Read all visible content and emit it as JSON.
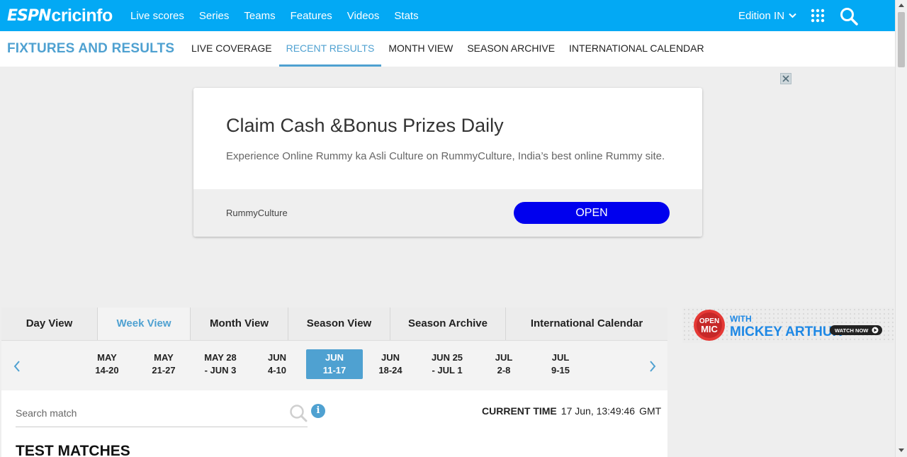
{
  "topbar": {
    "logo_espn": "ESPN",
    "logo_cric": "cricinfo",
    "nav": [
      "Live scores",
      "Series",
      "Teams",
      "Features",
      "Videos",
      "Stats"
    ],
    "edition": "Edition IN",
    "icons": {
      "apps": "grid-icon",
      "search": "search-icon",
      "chevron": "chevron-down-icon"
    },
    "bg_color": "#03a9f4"
  },
  "subbar": {
    "title": "FIXTURES AND RESULTS",
    "items": [
      "LIVE COVERAGE",
      "RECENT RESULTS",
      "MONTH VIEW",
      "SEASON ARCHIVE",
      "INTERNATIONAL CALENDAR"
    ],
    "active_index": 1,
    "accent_color": "#4fa1d1"
  },
  "ad": {
    "headline": "Claim Cash &Bonus Prizes Daily",
    "description": "Experience Online Rummy ka Asli Culture on RummyCulture, India’s best online Rummy site.",
    "brand": "RummyCulture",
    "cta": "OPEN",
    "cta_color": "#0000ee"
  },
  "views": {
    "tabs": [
      "Day View",
      "Week View",
      "Month View",
      "Season View",
      "Season Archive",
      "International Calendar"
    ],
    "active_index": 1
  },
  "weeks": {
    "items": [
      {
        "line1": "MAY",
        "line2": "14-20"
      },
      {
        "line1": "MAY",
        "line2": "21-27"
      },
      {
        "line1": "MAY 28",
        "line2": "- JUN 3"
      },
      {
        "line1": "JUN",
        "line2": "4-10"
      },
      {
        "line1": "JUN",
        "line2": "11-17"
      },
      {
        "line1": "JUN",
        "line2": "18-24"
      },
      {
        "line1": "JUN 25",
        "line2": "- JUL 1"
      },
      {
        "line1": "JUL",
        "line2": "2-8"
      },
      {
        "line1": "JUL",
        "line2": "9-15"
      }
    ],
    "active_index": 4
  },
  "search": {
    "placeholder": "Search match"
  },
  "time": {
    "label": "CURRENT TIME",
    "value": "17 Jun, 13:49:46",
    "tz": "GMT"
  },
  "section": {
    "heading": "TEST MATCHES"
  },
  "promo": {
    "line1": "OPEN",
    "line2": "MIC",
    "with": "WITH",
    "name": "MICKEY ARTHUR",
    "cta": "WATCH NOW"
  }
}
